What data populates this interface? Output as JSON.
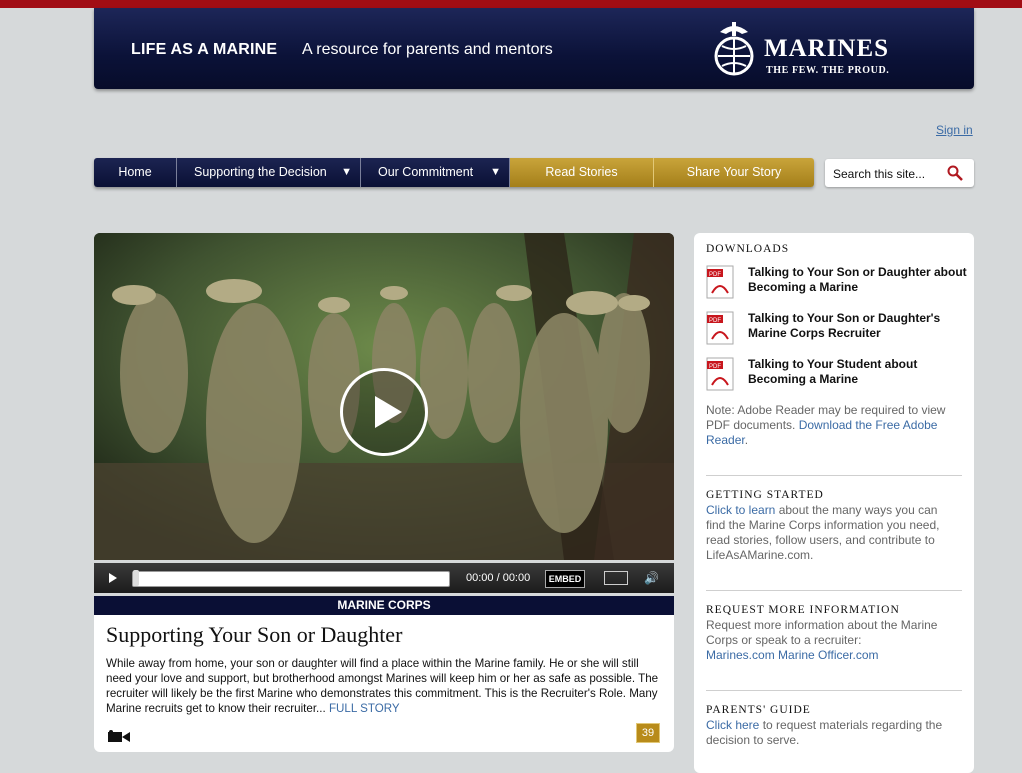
{
  "header": {
    "title": "LIFE AS A MARINE",
    "tagline": "A resource for parents and mentors",
    "logo_wordmark": "MARINES",
    "logo_slogan": "THE FEW. THE PROUD."
  },
  "account": {
    "signin": "Sign in"
  },
  "nav": {
    "items": [
      {
        "label": "Home"
      },
      {
        "label": "Supporting the Decision"
      },
      {
        "label": "Our Commitment"
      },
      {
        "label": "Read Stories"
      },
      {
        "label": "Share Your Story"
      }
    ]
  },
  "search": {
    "placeholder": "Search this site..."
  },
  "video": {
    "time": "00:00 / 00:00",
    "embed_label": "EMBED",
    "progress": 0
  },
  "story": {
    "category": "MARINE CORPS",
    "title": "Supporting Your Son or Daughter",
    "excerpt": "While away from home, your son or daughter will find a place within the Marine family. He or she will still need your love and support, but brotherhood amongst Marines will keep him or her as safe as possible. The recruiter will likely be the first Marine who demonstrates this commitment. This is the Recruiter's Role. Many Marine recruits get to know their recruiter...",
    "more_link": "FULL STORY",
    "comment_count": "39"
  },
  "sidebar": {
    "downloads_heading": "DOWNLOADS",
    "downloads": [
      {
        "title": "Talking to Your Son or Daughter about Becoming a Marine"
      },
      {
        "title": "Talking to Your Son or Daughter's Marine Corps Recruiter"
      },
      {
        "title": "Talking to Your Student about Becoming a Marine"
      }
    ],
    "pdf_note": "Note: Adobe Reader may be required to view PDF documents.",
    "pdf_link": "Download the Free Adobe Reader",
    "getting_started_heading": "GETTING STARTED",
    "getting_started_link": "Click to learn",
    "getting_started_text": "about the many ways you can find the Marine Corps information you need, read stories, follow users, and contribute to LifeAsAMarine.com.",
    "request_heading": "REQUEST MORE INFORMATION",
    "request_text": "Request more information about the Marine Corps or speak to a recruiter:",
    "request_link1": "Marines.com",
    "request_link2": "Marine Officer.com",
    "guide_heading": "PARENTS' GUIDE",
    "guide_link": "Click here",
    "guide_text": "to request materials regarding the decision to serve."
  },
  "colors": {
    "navy": "#0b1238",
    "gold": "#b88b1a",
    "red": "#a10d14",
    "link": "#3b6ba5"
  }
}
